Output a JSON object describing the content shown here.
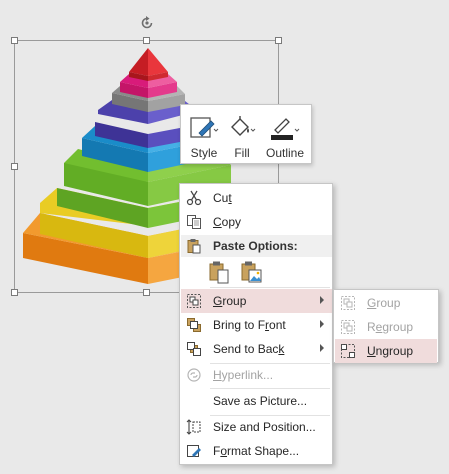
{
  "mini_toolbar": {
    "style_label": "Style",
    "fill_label": "Fill",
    "outline_label": "Outline"
  },
  "context_menu": {
    "cut": {
      "pre": "Cu",
      "key": "t",
      "post": ""
    },
    "copy": {
      "pre": "",
      "key": "C",
      "post": "opy"
    },
    "paste_options_label": "Paste Options:",
    "group": {
      "pre": "",
      "key": "G",
      "post": "roup"
    },
    "bring_to_front": {
      "pre": "Bring to F",
      "key": "r",
      "post": "ont"
    },
    "send_to_back": {
      "pre": "Send to Bac",
      "key": "k",
      "post": ""
    },
    "hyperlink": {
      "pre": "",
      "key": "H",
      "post": "yperlink..."
    },
    "save_as_picture": {
      "pre": "Save as Picture...",
      "key": "",
      "post": ""
    },
    "size_and_position": {
      "pre": "Size and Position...",
      "key": "",
      "post": ""
    },
    "format_shape": {
      "pre": "F",
      "key": "o",
      "post": "rmat Shape..."
    }
  },
  "group_submenu": {
    "group": {
      "pre": "",
      "key": "G",
      "post": "roup"
    },
    "regroup": {
      "pre": "R",
      "key": "e",
      "post": "group"
    },
    "ungroup": {
      "pre": "",
      "key": "U",
      "post": "ngroup"
    }
  },
  "colors": {
    "highlight": "#f0dcdc",
    "pyramid_layers": [
      "#d8232a",
      "#d81b7a",
      "#8a8a8a",
      "#4a3fa6",
      "#1b8fc8",
      "#6cb52e",
      "#e2c81b",
      "#ef8a18"
    ]
  }
}
